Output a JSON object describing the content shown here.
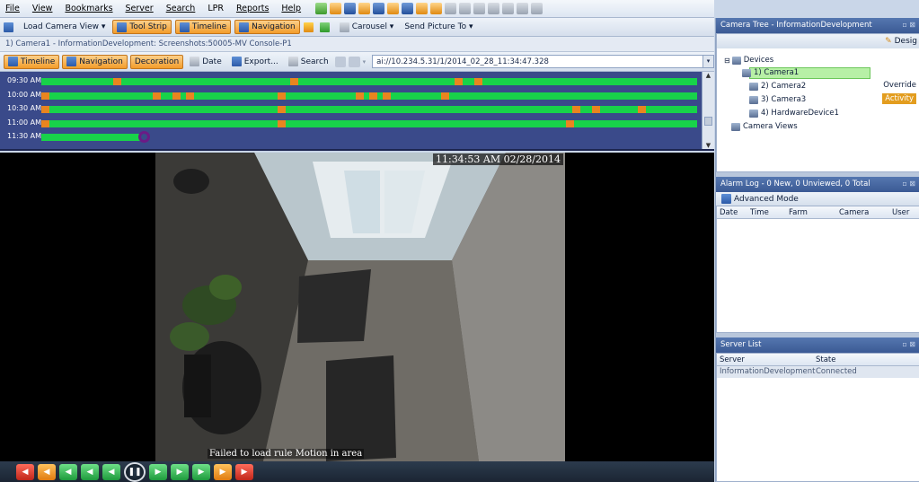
{
  "menu": [
    "File",
    "View",
    "Bookmarks",
    "Server",
    "Search",
    "LPR",
    "Reports",
    "Help"
  ],
  "toolbar1": {
    "load_camera_view": "Load Camera View ▾",
    "tool_strip": "Tool Strip",
    "timeline": "Timeline",
    "navigation": "Navigation",
    "carousel": "Carousel ▾",
    "send_picture_to": "Send Picture To ▾"
  },
  "caption": "1) Camera1 - InformationDevelopment: Screenshots:50005-MV Console-P1",
  "toolbar2": {
    "timeline": "Timeline",
    "navigation": "Navigation",
    "decoration": "Decoration",
    "date": "Date",
    "export": "Export...",
    "search": "Search",
    "address": "ai://10.234.5.31/1/2014_02_28_11:34:47.328"
  },
  "timeline": {
    "rows": [
      {
        "label": "09:30 AM",
        "coverage": 1.0,
        "events": [
          0.11,
          0.38,
          0.63,
          0.66
        ]
      },
      {
        "label": "10:00 AM",
        "coverage": 1.0,
        "events": [
          0.0,
          0.17,
          0.2,
          0.22,
          0.36,
          0.48,
          0.5,
          0.52,
          0.61
        ]
      },
      {
        "label": "10:30 AM",
        "coverage": 1.0,
        "events": [
          0.0,
          0.36,
          0.81,
          0.84,
          0.91
        ]
      },
      {
        "label": "11:00 AM",
        "coverage": 1.0,
        "events": [
          0.0,
          0.36,
          0.8
        ]
      },
      {
        "label": "11:30 AM",
        "coverage": 0.15,
        "events": []
      }
    ]
  },
  "video": {
    "timestamp": "11:34:53 AM 02/28/2014",
    "message": "Failed to load rule Motion in area"
  },
  "camera_tree": {
    "title": "Camera Tree - InformationDevelopment",
    "design": "Desig",
    "items": [
      "Devices",
      "1) Camera1",
      "2) Camera2",
      "3) Camera3",
      "4) HardwareDevice1",
      "Camera Views"
    ],
    "side_labels": {
      "override": "Override",
      "activity": "Activity"
    }
  },
  "alarm_log": {
    "title": "Alarm Log - 0 New, 0 Unviewed, 0 Total",
    "advanced_mode": "Advanced Mode",
    "columns": [
      "Date",
      "Time",
      "Farm",
      "Camera",
      "User"
    ]
  },
  "server_list": {
    "title": "Server List",
    "columns": [
      "Server",
      "State"
    ],
    "rows": [
      {
        "server": "InformationDevelopment",
        "state": "Connected"
      }
    ]
  },
  "playback": {
    "buttons": [
      "skip-start",
      "prev-event",
      "step-back-fast",
      "step-back",
      "rewind",
      "pause",
      "play",
      "step-forward",
      "step-forward-fast",
      "next-event",
      "skip-end"
    ]
  }
}
